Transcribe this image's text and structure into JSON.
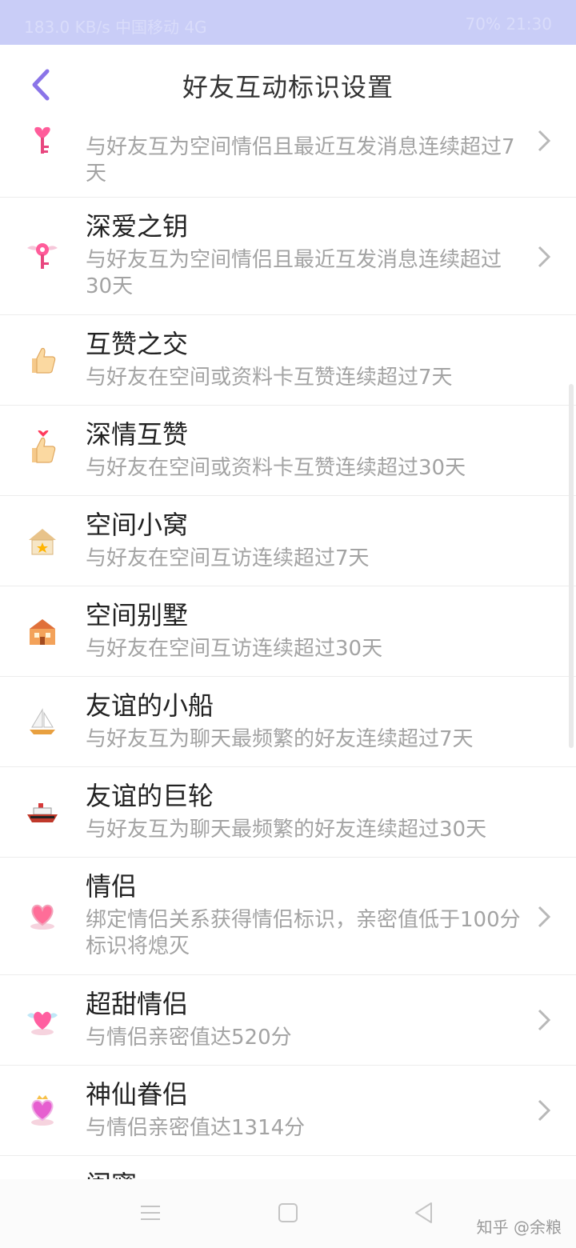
{
  "status_bar": {
    "left": "183.0 KB/s  中国移动 4G",
    "right": "70%  21:30"
  },
  "header": {
    "title": "好友互动标识设置"
  },
  "items": [
    {
      "title": "",
      "desc": "与好友互为空间情侣且最近互发消息连续超过7天",
      "icon": "pink-key-icon",
      "has_chevron": true
    },
    {
      "title": "深爱之钥",
      "desc": "与好友互为空间情侣且最近互发消息连续超过30天",
      "icon": "winged-key-icon",
      "has_chevron": true
    },
    {
      "title": "互赞之交",
      "desc": "与好友在空间或资料卡互赞连续超过7天",
      "icon": "thumbs-up-icon",
      "has_chevron": false
    },
    {
      "title": "深情互赞",
      "desc": "与好友在空间或资料卡互赞连续超过30天",
      "icon": "thumbs-up-heart-icon",
      "has_chevron": false
    },
    {
      "title": "空间小窝",
      "desc": "与好友在空间互访连续超过7天",
      "icon": "small-house-icon",
      "has_chevron": false
    },
    {
      "title": "空间别墅",
      "desc": "与好友在空间互访连续超过30天",
      "icon": "villa-icon",
      "has_chevron": false
    },
    {
      "title": "友谊的小船",
      "desc": "与好友互为聊天最频繁的好友连续超过7天",
      "icon": "sailboat-icon",
      "has_chevron": false
    },
    {
      "title": "友谊的巨轮",
      "desc": "与好友互为聊天最频繁的好友连续超过30天",
      "icon": "cruise-ship-icon",
      "has_chevron": false
    },
    {
      "title": "情侣",
      "desc": "绑定情侣关系获得情侣标识，亲密值低于100分标识将熄灭",
      "icon": "heart-icon",
      "has_chevron": true
    },
    {
      "title": "超甜情侣",
      "desc": "与情侣亲密值达520分",
      "icon": "winged-heart-icon",
      "has_chevron": true
    },
    {
      "title": "神仙眷侣",
      "desc": "与情侣亲密值达1314分",
      "icon": "crowned-heart-icon",
      "has_chevron": true
    },
    {
      "title": "闺蜜",
      "desc": "",
      "icon": "",
      "has_chevron": false
    }
  ],
  "watermark": "知乎 @余粮"
}
